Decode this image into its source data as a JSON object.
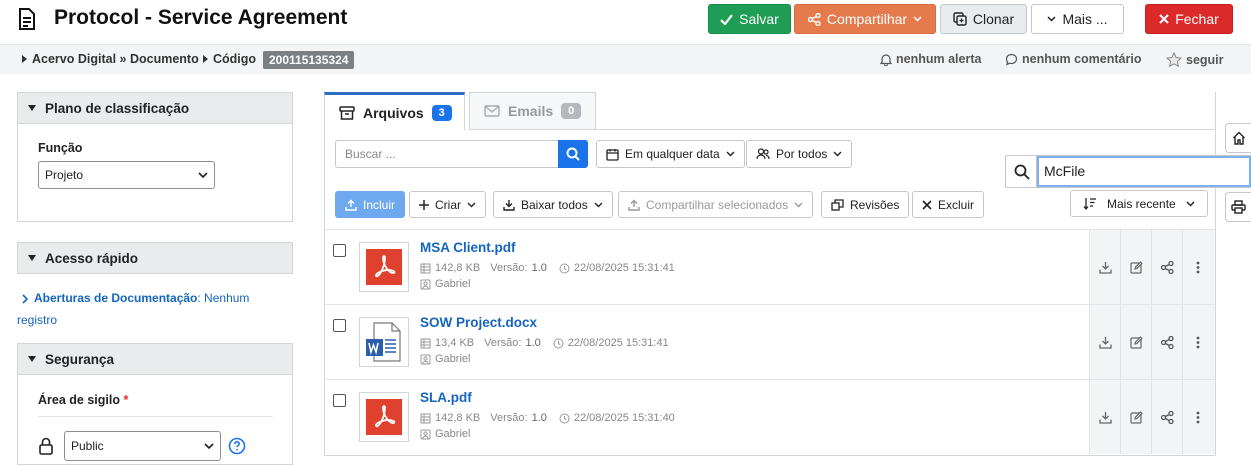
{
  "header": {
    "title": "Protocol - Service Agreement",
    "buttons": {
      "salvar": "Salvar",
      "compartilhar": "Compartilhar",
      "clonar": "Clonar",
      "mais": "Mais ...",
      "fechar": "Fechar"
    }
  },
  "breadcrumb": {
    "items": [
      "Acervo Digital » Documento",
      "Código"
    ],
    "code": "200115135324",
    "alert": "nenhum alerta",
    "comment": "nenhum comentário",
    "follow": "seguir"
  },
  "sidebar": {
    "classificacao": {
      "title": "Plano de classificação",
      "funcao_label": "Função",
      "funcao_value": "Projeto"
    },
    "acesso": {
      "title": "Acesso rápido",
      "link": "Aberturas de Documentação",
      "link_suffix": ": Nenhum",
      "link_suffix2": "registro"
    },
    "seguranca": {
      "title": "Segurança",
      "area_label": "Área de sigilo",
      "required_mark": "*",
      "area_value": "Public"
    }
  },
  "tabs": {
    "arquivos": {
      "label": "Arquivos",
      "count": "3"
    },
    "emails": {
      "label": "Emails",
      "count": "0"
    }
  },
  "toolbar": {
    "search_placeholder": "Buscar ...",
    "date_filter": "Em qualquer data",
    "user_filter": "Por todos",
    "incluir": "Incluir",
    "criar": "Criar",
    "baixar": "Baixar todos",
    "compartilhar_sel": "Compartilhar selecionados",
    "revisoes": "Revisões",
    "excluir": "Excluir",
    "sort": "Mais recente"
  },
  "overlay_search": {
    "value": "McFile"
  },
  "files": [
    {
      "name": "MSA Client.pdf",
      "type": "pdf",
      "size": "142,8 KB",
      "version_label": "Versão:",
      "version": "1.0",
      "date": "22/08/2025 15:31:41",
      "author": "Gabriel"
    },
    {
      "name": "SOW Project.docx",
      "type": "docx",
      "size": "13,4 KB",
      "version_label": "Versão:",
      "version": "1.0",
      "date": "22/08/2025 15:31:41",
      "author": "Gabriel"
    },
    {
      "name": "SLA.pdf",
      "type": "pdf",
      "size": "142,8 KB",
      "version_label": "Versão:",
      "version": "1.0",
      "date": "22/08/2025 15:31:40",
      "author": "Gabriel"
    }
  ],
  "colors": {
    "accent": "#1a73e8",
    "save": "#1f9d55",
    "share": "#e57a4c",
    "close": "#dc2a2a",
    "pdf": "#e0412f",
    "word": "#2b5fad"
  }
}
